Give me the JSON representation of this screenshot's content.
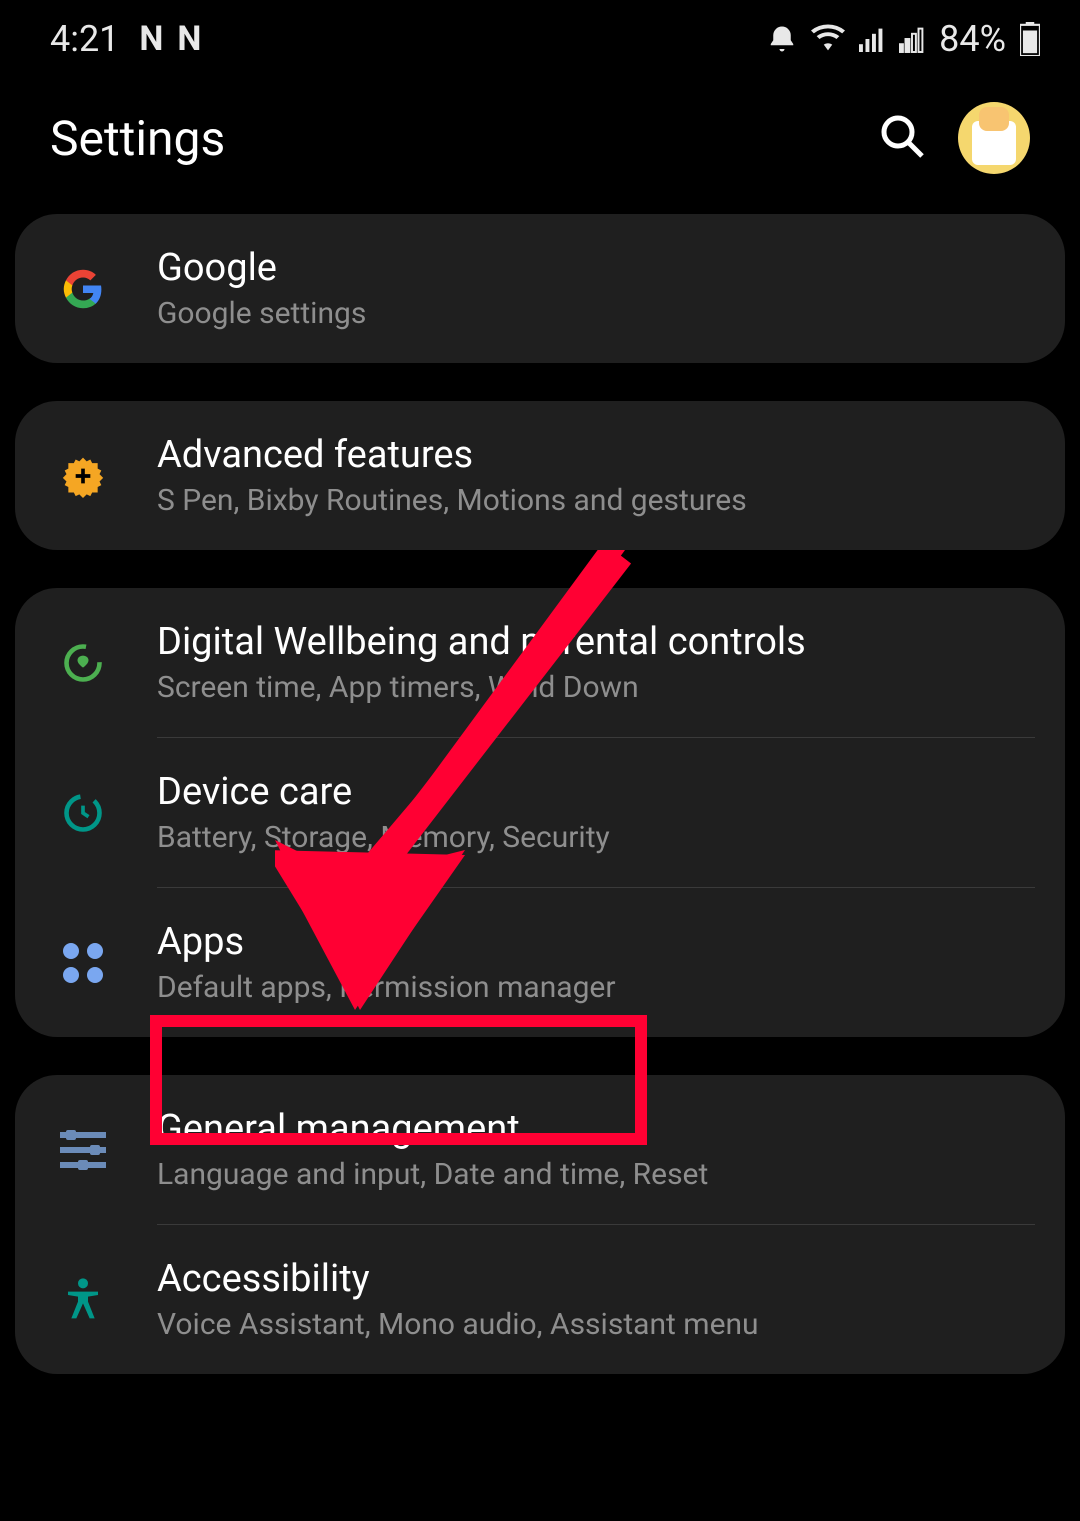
{
  "status_bar": {
    "time": "4:21",
    "app_indicators": [
      "N",
      "N"
    ],
    "battery": "84%"
  },
  "header": {
    "title": "Settings"
  },
  "groups": [
    {
      "items": [
        {
          "title": "Google",
          "subtitle": "Google settings",
          "icon": "google"
        }
      ]
    },
    {
      "items": [
        {
          "title": "Advanced features",
          "subtitle": "S Pen, Bixby Routines, Motions and gestures",
          "icon": "gear-plus"
        }
      ]
    },
    {
      "items": [
        {
          "title": "Digital Wellbeing and parental controls",
          "subtitle": "Screen time, App timers, Wind Down",
          "icon": "wellbeing"
        },
        {
          "title": "Device care",
          "subtitle": "Battery, Storage, Memory, Security",
          "icon": "device-care"
        },
        {
          "title": "Apps",
          "subtitle": "Default apps, Permission manager",
          "icon": "apps"
        }
      ]
    },
    {
      "items": [
        {
          "title": "General management",
          "subtitle": "Language and input, Date and time, Reset",
          "icon": "sliders"
        },
        {
          "title": "Accessibility",
          "subtitle": "Voice Assistant, Mono audio, Assistant menu",
          "icon": "person"
        }
      ]
    }
  ],
  "annotation": {
    "target": "General management"
  }
}
